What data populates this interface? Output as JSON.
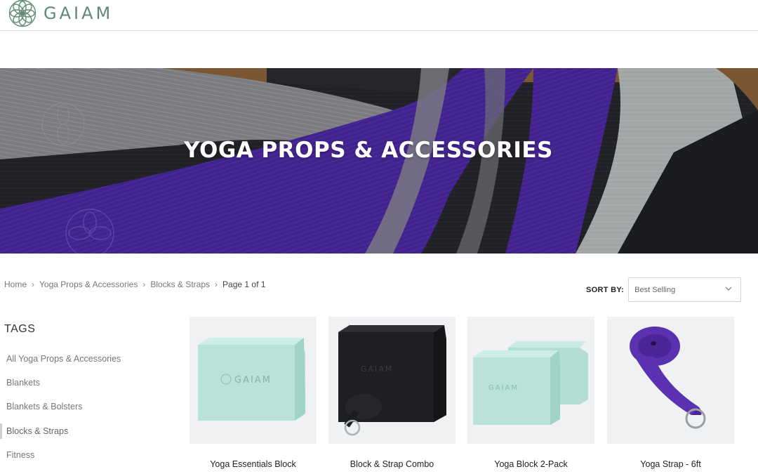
{
  "header": {
    "logo_text": "GAIAM"
  },
  "hero": {
    "title": "YOGA PROPS & ACCESSORIES"
  },
  "breadcrumb": {
    "items": [
      "Home",
      "Yoga Props & Accessories",
      "Blocks & Straps"
    ],
    "current": "Page 1 of 1"
  },
  "sort": {
    "label": "SORT BY:",
    "selected": "Best Selling"
  },
  "tags": {
    "title": "TAGS",
    "items": [
      {
        "label": "All Yoga Props & Accessories",
        "active": false
      },
      {
        "label": "Blankets",
        "active": false
      },
      {
        "label": "Blankets & Bolsters",
        "active": false
      },
      {
        "label": "Blocks & Straps",
        "active": true
      },
      {
        "label": "Fitness",
        "active": false
      }
    ]
  },
  "products": [
    {
      "name": "Yoga Essentials Block",
      "image": "mint-block-image"
    },
    {
      "name": "Block & Strap Combo",
      "image": "black-block-strap-image"
    },
    {
      "name": "Yoga Block 2-Pack",
      "image": "mint-block-2pack-image"
    },
    {
      "name": "Yoga Strap - 6ft",
      "image": "purple-strap-image"
    }
  ],
  "colors": {
    "brand": "#5e8a75",
    "mint": "#b8e2d8",
    "purple": "#5b2fa8",
    "hero_dark": "#1d1f24"
  }
}
